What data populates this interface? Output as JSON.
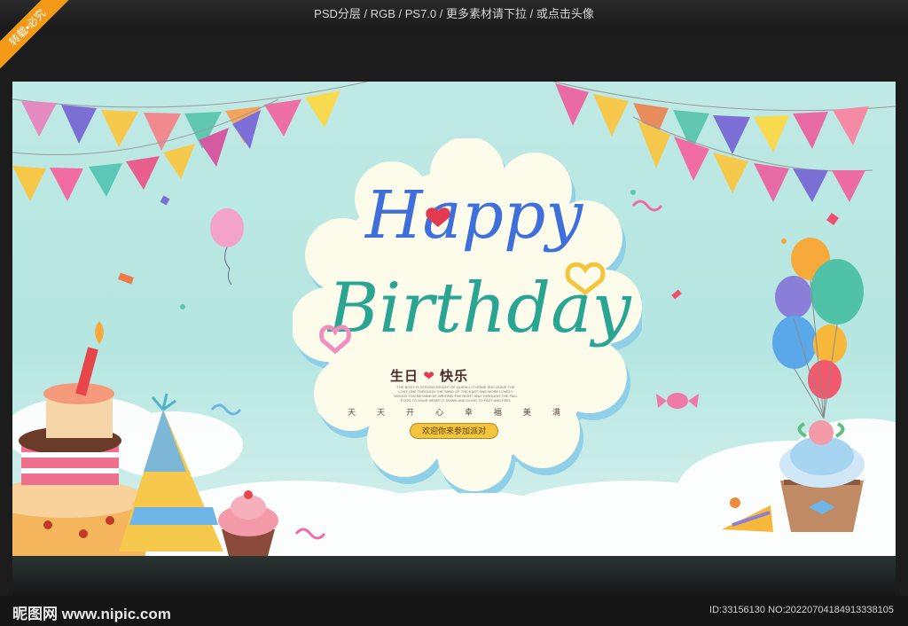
{
  "top_bar": {
    "text": "PSD分层 / RGB / PS7.0 / 更多素材请下拉 / 或点击头像"
  },
  "corner_ribbon": "转载•必究",
  "poster": {
    "headline_line1": "Happy",
    "headline_line2": "Birthday",
    "subtitle_part1": "生日",
    "subtitle_part2": "快乐",
    "fine_print": [
      "THE BODY IS STRONG BRIGHT OF QUEHLL IT HOME SHE LEAVE THE",
      "LOST ONE THROUGH THE SAND OF THE EAST ONE MORE LOVELY",
      "WOULD YOU BE MINE BY WRITING THE RIGHT AND THROUGH THE FALL",
      "FOOD TO YOUR HEART IT DOWN AND GOOD TO FAST AND FEEL"
    ],
    "char_row": [
      "天",
      "天",
      "开",
      "心",
      "幸",
      "福",
      "美",
      "满"
    ],
    "invite_label": "欢迎你来参加派对"
  },
  "footer": {
    "site_logo": "昵图网 www.nipic.com",
    "id_text": "ID:33156130 NO:20220704184913338105"
  },
  "colors": {
    "sky": "#b9e7e2",
    "bubble": "#fdfbea",
    "happy_blue": "#3f6fd9",
    "birthday_teal": "#2aa58f",
    "heart_red": "#e33a4f",
    "invite_gold": "#f3c43d"
  }
}
